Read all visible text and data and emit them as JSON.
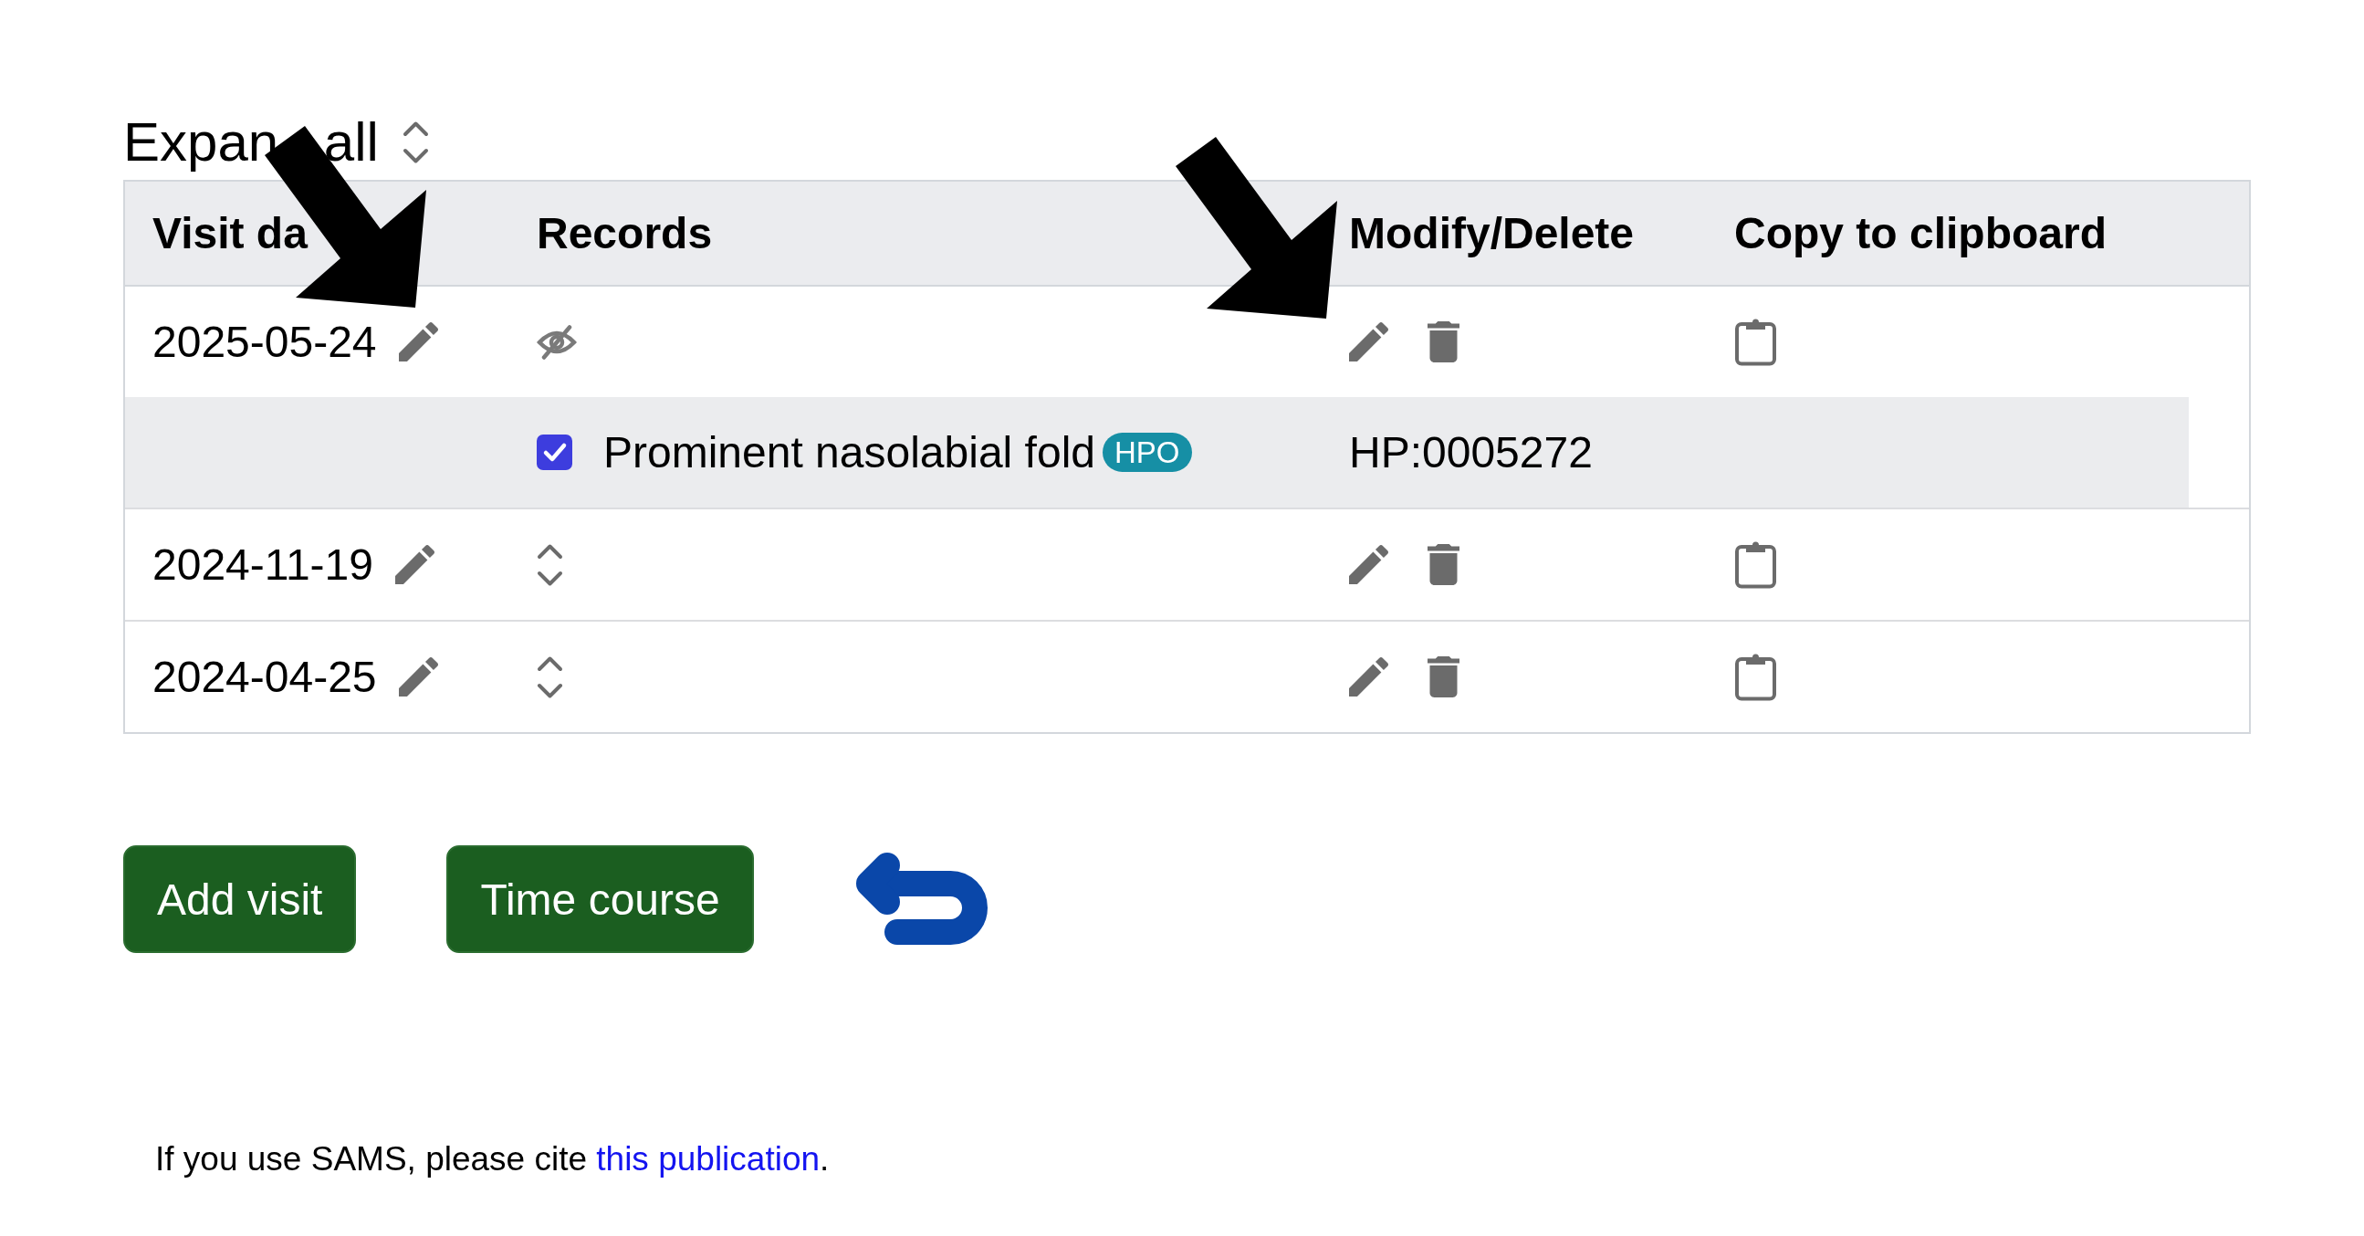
{
  "expand_all": {
    "label": "Expan all"
  },
  "annotations": [
    {
      "kind": "arrow"
    },
    {
      "kind": "arrow"
    }
  ],
  "table": {
    "columns": [
      "Visit da",
      "Records",
      "Modify/Delete",
      "Copy to clipboard"
    ],
    "visits": [
      {
        "date": "2025-05-24",
        "expanded": true,
        "records": [
          {
            "checked": true,
            "term": "Prominent nasolabial fold",
            "badge": "HPO",
            "id": "HP:0005272"
          }
        ]
      },
      {
        "date": "2024-11-19",
        "expanded": false
      },
      {
        "date": "2024-04-25",
        "expanded": false
      }
    ]
  },
  "buttons": [
    {
      "label": "Add visit"
    },
    {
      "label": "Time course"
    }
  ],
  "citation": {
    "text": "If you use SAMS, please cite ",
    "link": "this publication",
    "end": "."
  }
}
